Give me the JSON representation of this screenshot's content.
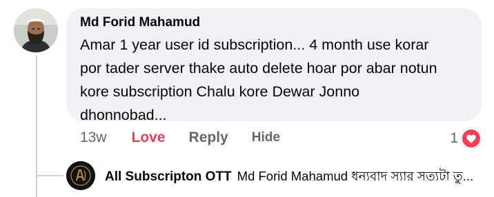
{
  "comment": {
    "author": "Md Forid Mahamud",
    "lines": [
      "Amar 1 year user id subscription... 4 month use korar",
      "por tader server thake auto delete hoar por abar notun",
      "kore subscription Chalu kore Dewar Jonno",
      "dhonnobad..."
    ],
    "timestamp": "13w",
    "love_label": "Love",
    "reply_label": "Reply",
    "hide_label": "Hide",
    "reaction_count": "1",
    "reaction_icon": "heart-icon"
  },
  "reply": {
    "author": "All Subscripton OTT",
    "text": "Md Forid Mahamud ধন্যবাদ স্যার সত্যটা তু..."
  },
  "colors": {
    "bubble_bg": "#f0f2f5",
    "love": "#e4415c",
    "muted": "#65676b",
    "heart": "#f33e58"
  }
}
